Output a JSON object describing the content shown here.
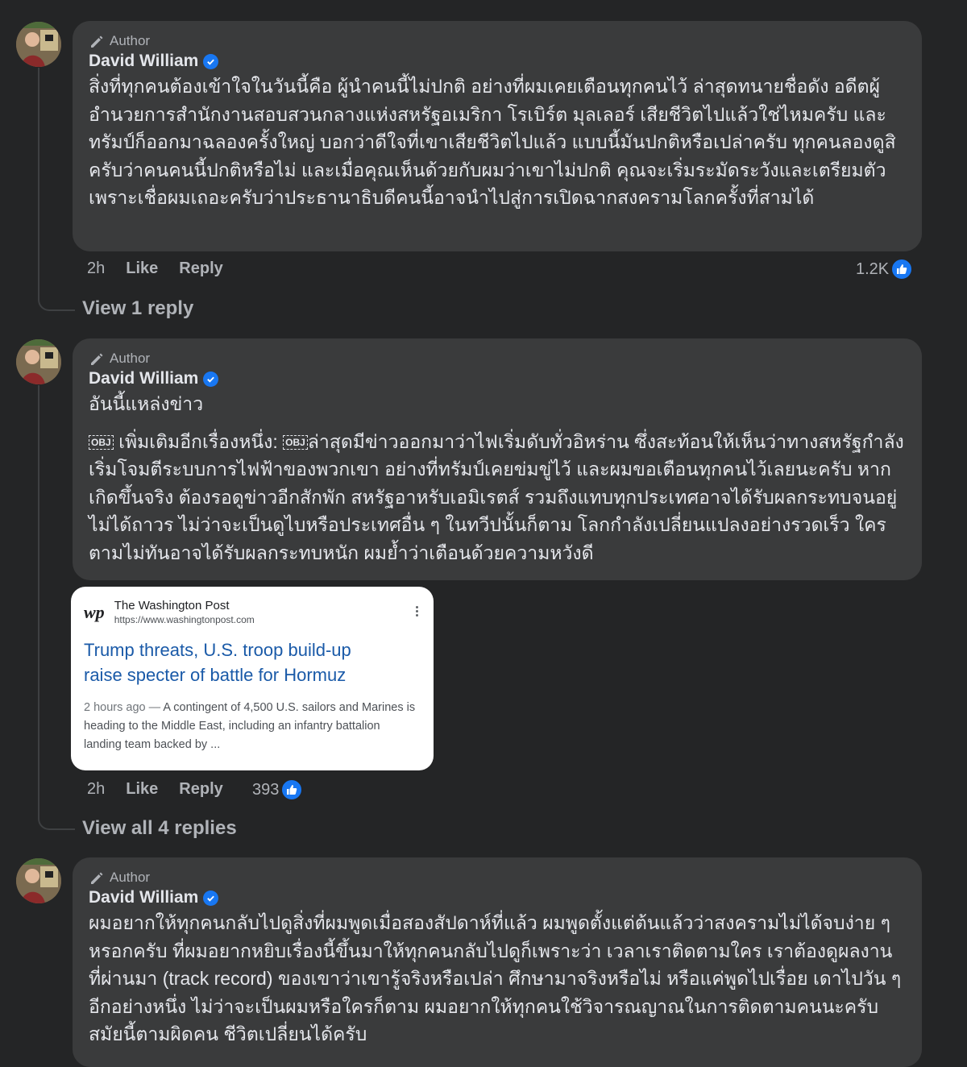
{
  "comments": [
    {
      "badge": "Author",
      "name": "David William",
      "text": "สิ่งที่ทุกคนต้องเข้าใจในวันนี้คือ ผู้นำคนนี้ไม่ปกติ อย่างที่ผมเคยเตือนทุกคนไว้ ล่าสุดทนายชื่อดัง อดีตผู้อำนวยการสำนักงานสอบสวนกลางแห่งสหรัฐอเมริกา โรเบิร์ต มุลเลอร์ เสียชีวิตไปแล้วใช่ไหมครับ และทรัมป์ก็ออกมาฉลองครั้งใหญ่ บอกว่าดีใจที่เขาเสียชีวิตไปแล้ว แบบนี้มันปกติหรือเปล่าครับ ทุกคนลองดูสิครับว่าคนคนนี้ปกติหรือไม่ และเมื่อคุณเห็นด้วยกับผมว่าเขาไม่ปกติ คุณจะเริ่มระมัดระวังและเตรียมตัว เพราะเชื่อผมเถอะครับว่าประธานาธิบดีคนนี้อาจนำไปสู่การเปิดฉากสงครามโลกครั้งที่สามได้",
      "time": "2h",
      "like": "Like",
      "reply": "Reply",
      "reactions": "1.2K",
      "view_replies": "View 1 reply"
    },
    {
      "badge": "Author",
      "name": "David William",
      "text": "อันนี้แหล่งข่าว",
      "text_tag1": "OBJ",
      "text_part1": " เพิ่มเติมอีกเรื่องหนึ่ง: ",
      "text_tag2": "OBJ",
      "text_part2": "ล่าสุดมีข่าวออกมาว่าไฟเริ่มดับทั่วอิหร่าน ซึ่งสะท้อนให้เห็นว่าทางสหรัฐกำลังเริ่มโจมตีระบบการไฟฟ้าของพวกเขา อย่างที่ทรัมป์เคยข่มขู่ไว้ และผมขอเตือนทุกคนไว้เลยนะครับ หากเกิดขึ้นจริง ต้องรอดูข่าวอีกสักพัก สหรัฐอาหรับเอมิเรตส์ รวมถึงแทบทุกประเทศอาจได้รับผลกระทบจนอยู่ไม่ได้ถาวร ไม่ว่าจะเป็นดูไบหรือประเทศอื่น ๆ ในทวีปนั้นก็ตาม โลกกำลังเปลี่ยนแปลงอย่างรวดเร็ว ใครตามไม่ทันอาจได้รับผลกระทบหนัก ผมย้ำว่าเตือนด้วยความหวังดี",
      "link": {
        "logo": "wp",
        "source": "The Washington Post",
        "url": "https://www.washingtonpost.com",
        "headline": "Trump threats, U.S. troop build-up raise specter of battle for Hormuz",
        "age": "2 hours ago",
        "dash": "—",
        "snippet": "A contingent of 4,500 U.S. sailors and Marines is heading to the Middle East, including an infantry battalion landing team backed by ..."
      },
      "time": "2h",
      "like": "Like",
      "reply": "Reply",
      "reactions": "393",
      "view_replies": "View all 4 replies"
    },
    {
      "badge": "Author",
      "name": "David William",
      "text": "ผมอยากให้ทุกคนกลับไปดูสิ่งที่ผมพูดเมื่อสองสัปดาห์ที่แล้ว ผมพูดตั้งแต่ต้นแล้วว่าสงครามไม่ได้จบง่าย ๆ หรอกครับ ที่ผมอยากหยิบเรื่องนี้ขึ้นมาให้ทุกคนกลับไปดูก็เพราะว่า เวลาเราติดตามใคร เราต้องดูผลงานที่ผ่านมา (track record) ของเขาว่าเขารู้จริงหรือเปล่า ศึกษามาจริงหรือไม่ หรือแค่พูดไปเรื่อย เดาไปวัน ๆ อีกอย่างหนึ่ง ไม่ว่าจะเป็นผมหรือใครก็ตาม ผมอยากให้ทุกคนใช้วิจารณญาณในการติดตามคนนะครับ สมัยนี้ตามผิดคน ชีวิตเปลี่ยนได้ครับ"
    }
  ],
  "colors": {
    "background": "#242526",
    "bubble": "#3a3b3c",
    "text": "#e4e6eb",
    "muted": "#b0b3b8",
    "accent": "#1877f2",
    "link_headline": "#1a5aa8"
  },
  "icons": {
    "badge": "pencil-icon",
    "verified": "verified-check-icon",
    "reaction": "thumbs-up-icon",
    "menu": "kebab-menu-icon"
  }
}
